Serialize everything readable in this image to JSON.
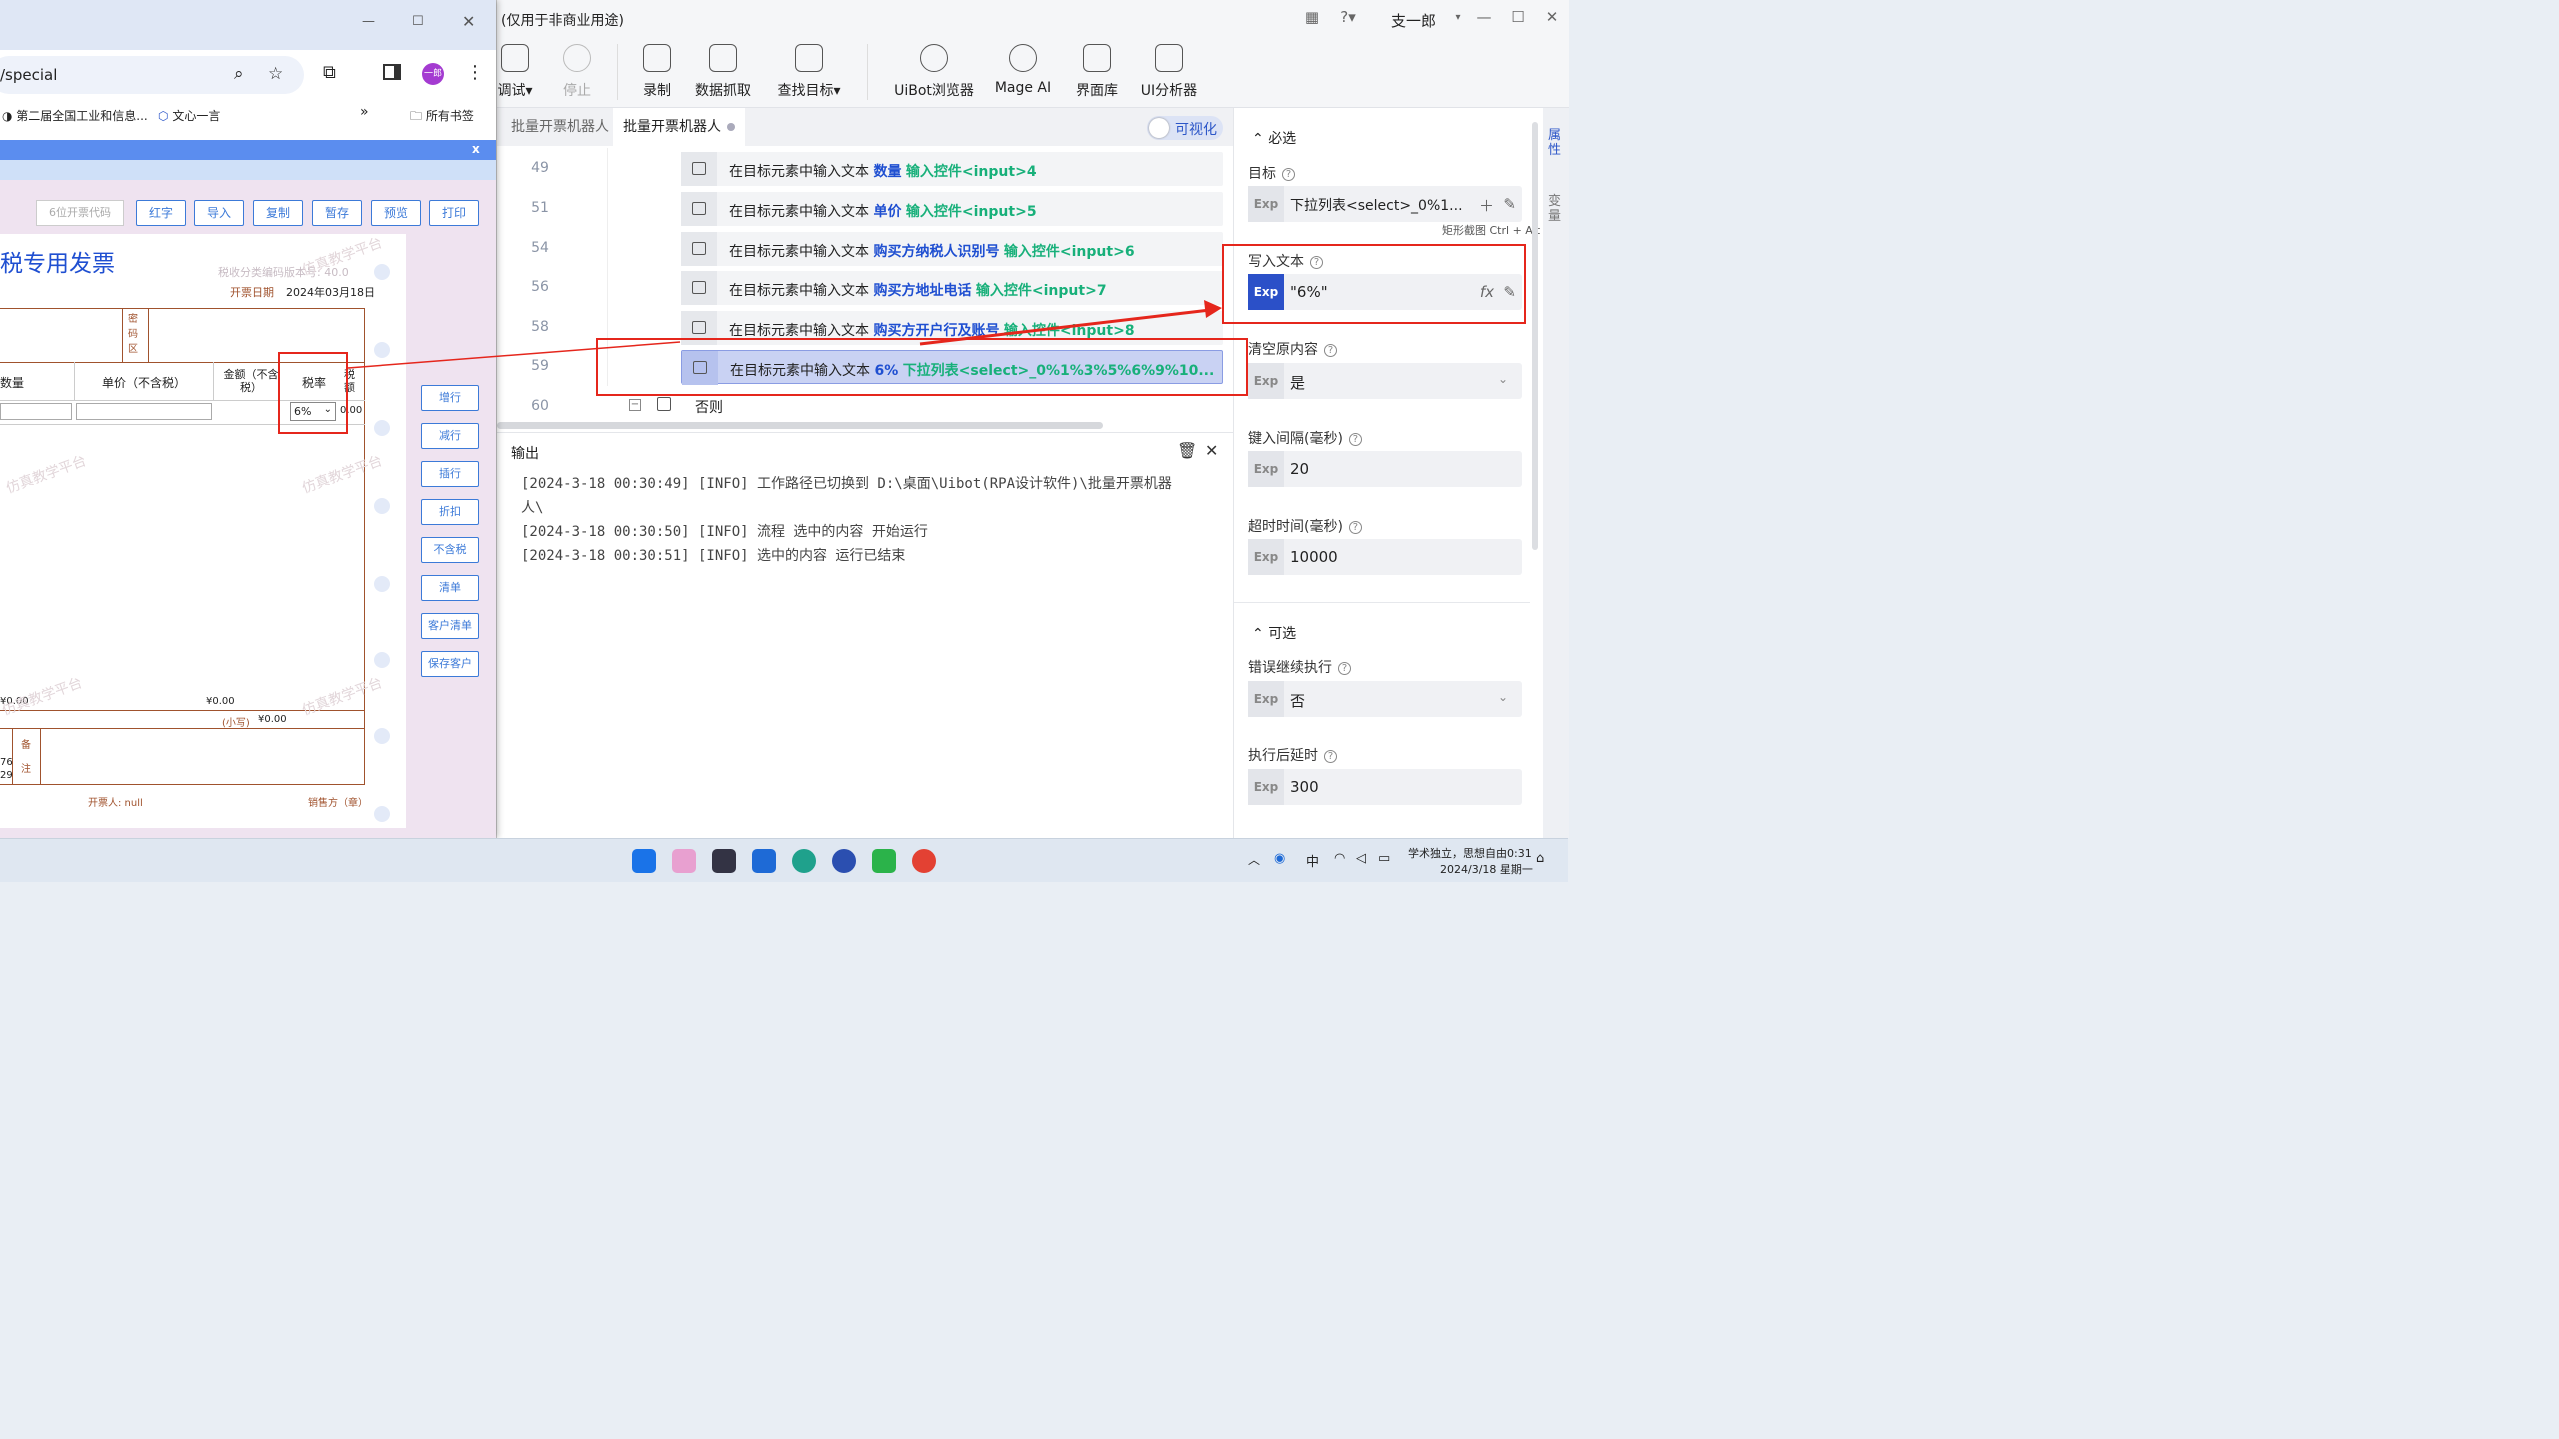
{
  "app": {
    "title": "(仅用于非商业用途)",
    "user": "支一郎",
    "toolbar": [
      {
        "label": "调试▾",
        "icon": "debug-icon",
        "disabled": false
      },
      {
        "label": "停止",
        "icon": "stop-icon",
        "disabled": true
      },
      {
        "label": "录制",
        "icon": "record-icon",
        "disabled": false
      },
      {
        "label": "数据抓取",
        "icon": "data-scrape-icon",
        "disabled": false
      },
      {
        "label": "查找目标▾",
        "icon": "find-target-icon",
        "disabled": false
      },
      {
        "label": "UiBot浏览器",
        "icon": "uibot-browser-icon",
        "disabled": false
      },
      {
        "label": "Mage AI",
        "icon": "mage-ai-icon",
        "disabled": false
      },
      {
        "label": "界面库",
        "icon": "ui-library-icon",
        "disabled": false
      },
      {
        "label": "UI分析器",
        "icon": "ui-analyzer-icon",
        "disabled": false
      }
    ],
    "tabs": [
      {
        "label": "批量开票机器人",
        "active": false
      },
      {
        "label": "批量开票机器人",
        "active": true
      }
    ],
    "visual_toggle": "可视化",
    "flow_rows": [
      {
        "line": "49",
        "text": "在目标元素中输入文本",
        "value": "数量",
        "target": "输入控件<input>4"
      },
      {
        "line": "51",
        "text": "在目标元素中输入文本",
        "value": "单价",
        "target": "输入控件<input>5"
      },
      {
        "line": "54",
        "text": "在目标元素中输入文本",
        "value": "购买方纳税人识别号",
        "target": "输入控件<input>6"
      },
      {
        "line": "56",
        "text": "在目标元素中输入文本",
        "value": "购买方地址电话",
        "target": "输入控件<input>7"
      },
      {
        "line": "58",
        "text": "在目标元素中输入文本",
        "value": "购买方开户行及账号",
        "target": "输入控件<input>8"
      },
      {
        "line": "59",
        "text": "在目标元素中输入文本",
        "value": "6%",
        "target": "下拉列表<select>_0%1%3%5%6%9%10..."
      }
    ],
    "else_row": {
      "line": "60",
      "text": "否则"
    },
    "output": {
      "title": "输出",
      "logs": [
        "[2024-3-18 00:30:49] [INFO] 工作路径已切换到 D:\\桌面\\Uibot(RPA设计软件)\\批量开票机器",
        "人\\",
        "[2024-3-18 00:30:50] [INFO] 流程 选中的内容 开始运行",
        "[2024-3-18 00:30:51] [INFO] 选中的内容 运行已结束"
      ]
    },
    "props": {
      "required": "必选",
      "optional": "可选",
      "target_label": "目标",
      "target_value": "下拉列表<select>_0%1...",
      "tooltip": "矩形截图 Ctrl + Alt + A",
      "write_label": "写入文本",
      "write_value": "\"6%\"",
      "clear_label": "清空原内容",
      "clear_value": "是",
      "interval_label": "键入间隔(毫秒)",
      "interval_value": "20",
      "timeout_label": "超时时间(毫秒)",
      "timeout_value": "10000",
      "continue_label": "错误继续执行",
      "continue_value": "否",
      "delay_label": "执行后延时",
      "delay_value": "300",
      "exp": "Exp",
      "fx": "fx"
    },
    "side_tabs": [
      "属性",
      "变量"
    ]
  },
  "browser": {
    "url": "/special",
    "bookmarks": [
      "第二届全国工业和信息...",
      "文心一言",
      "所有书签"
    ],
    "close_x": "x",
    "tax_code_placeholder": "6位开票代码",
    "top_buttons": [
      "红字",
      "导入",
      "复制",
      "暂存",
      "预览",
      "打印"
    ],
    "side_buttons": [
      "增行",
      "减行",
      "插行",
      "折扣",
      "不含税",
      "清单",
      "客户清单",
      "保存客户"
    ],
    "invoice": {
      "title": "税专用发票",
      "version": "税收分类编码版本号: 40.0",
      "date_label": "开票日期",
      "date": "2024年03月18日",
      "cipher": "密码区",
      "col_qty": "数量",
      "col_price": "单价（不含税）",
      "col_amount": "金额（不含税）",
      "col_rate": "税率",
      "col_tax": "税额",
      "rate_value": "6%",
      "tax_value": "0.00",
      "total_left": "¥0.00",
      "total_amount": "¥0.00",
      "small_label": "(小写)",
      "small_value": "¥0.00",
      "remark": "备注",
      "side_digits": "76\n29",
      "issuer": "开票人: null",
      "seller": "销售方（章）",
      "watermark": "仿真教学平台"
    }
  },
  "taskbar": {
    "tray_text_1": "学术独立，思想自由0:31",
    "tray_text_2": "2024/3/18 星期一",
    "ime": "中"
  }
}
